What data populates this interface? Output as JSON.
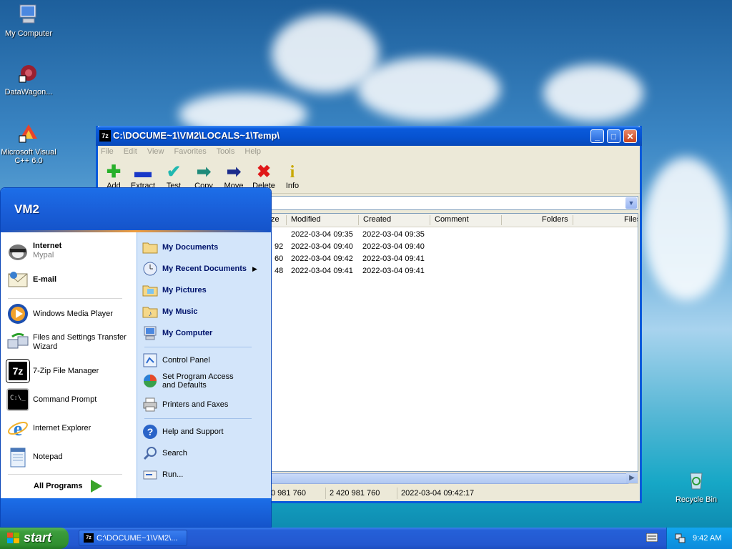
{
  "desktop": {
    "icons": [
      {
        "label": "My Computer",
        "icon": "my-computer-icon"
      },
      {
        "label": "DataWagon...",
        "icon": "datawagon-icon"
      },
      {
        "label": "Microsoft Visual C++ 6.0",
        "icon": "visual-cpp-icon"
      },
      {
        "label": "Recycle Bin",
        "icon": "recycle-bin-icon"
      }
    ]
  },
  "window": {
    "title": "C:\\DOCUME~1\\VM2\\LOCALS~1\\Temp\\",
    "menu": [
      "File",
      "Edit",
      "View",
      "Favorites",
      "Tools",
      "Help"
    ],
    "toolbar": [
      "Add",
      "Extract",
      "Test",
      "Copy",
      "Move",
      "Delete",
      "Info"
    ],
    "columns": {
      "size_partial": "ze",
      "modified": "Modified",
      "created": "Created",
      "comment": "Comment",
      "folders": "Folders",
      "files": "Files"
    },
    "rows": [
      {
        "size": "",
        "modified": "2022-03-04 09:35",
        "created": "2022-03-04 09:35"
      },
      {
        "size": "92",
        "modified": "2022-03-04 09:40",
        "created": "2022-03-04 09:40"
      },
      {
        "size": "60",
        "modified": "2022-03-04 09:42",
        "created": "2022-03-04 09:41"
      },
      {
        "size": "48",
        "modified": "2022-03-04 09:41",
        "created": "2022-03-04 09:41"
      }
    ],
    "status": {
      "size1": "0 981 760",
      "size2": "2 420 981 760",
      "datetime": "2022-03-04 09:42:17"
    }
  },
  "start_menu": {
    "user": "VM2",
    "pinned": {
      "internet": {
        "label": "Internet",
        "sub": "Mypal"
      },
      "email": {
        "label": "E-mail"
      }
    },
    "recent": [
      "Windows Media Player",
      "Files and Settings Transfer Wizard",
      "7-Zip File Manager",
      "Command Prompt",
      "Internet Explorer",
      "Notepad"
    ],
    "all_programs": "All Programs",
    "right": {
      "my_documents": "My Documents",
      "my_recent_documents": "My Recent Documents",
      "my_pictures": "My Pictures",
      "my_music": "My Music",
      "my_computer": "My Computer",
      "control_panel": "Control Panel",
      "set_program_access": "Set Program Access and Defaults",
      "printers": "Printers and Faxes",
      "help": "Help and Support",
      "search": "Search",
      "run": "Run..."
    }
  },
  "taskbar": {
    "start": "start",
    "task": "C:\\DOCUME~1\\VM2\\...",
    "clock": "9:42 AM"
  },
  "colors": {
    "taskbar_blue": "#2358d0",
    "start_green": "#3c9c3c",
    "title_blue": "#0a5adb"
  }
}
